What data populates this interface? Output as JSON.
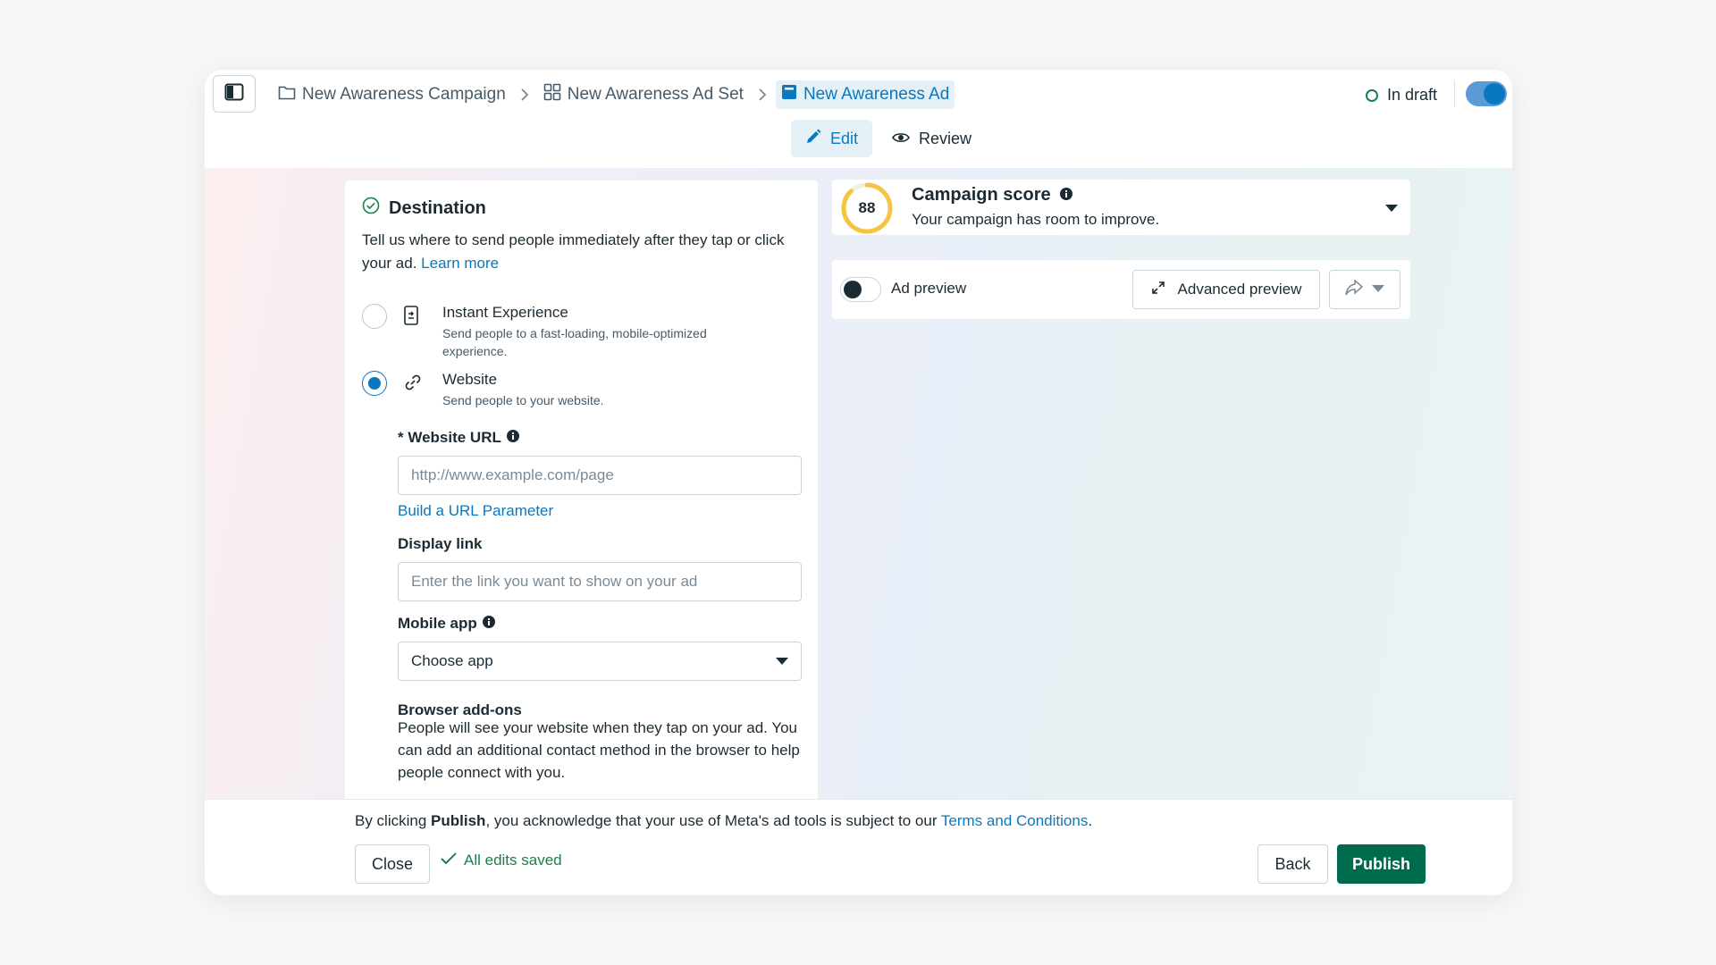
{
  "breadcrumb": {
    "items": [
      {
        "label": "New Awareness Campaign",
        "icon": "folder-icon"
      },
      {
        "label": "New Awareness Ad Set",
        "icon": "grid-icon"
      },
      {
        "label": "New Awareness Ad",
        "icon": "ad-icon"
      }
    ]
  },
  "status": {
    "label": "In draft"
  },
  "tabs": [
    {
      "label": "Edit",
      "icon": "pencil-icon",
      "active": true
    },
    {
      "label": "Review",
      "icon": "eye-icon",
      "active": false
    }
  ],
  "destination": {
    "title": "Destination",
    "description": "Tell us where to send people immediately after they tap or click your ad.",
    "learn_more": "Learn more",
    "options": [
      {
        "title": "Instant Experience",
        "subtitle": "Send people to a fast-loading, mobile-optimized experience.",
        "selected": false
      },
      {
        "title": "Website",
        "subtitle": "Send people to your website.",
        "selected": true
      }
    ],
    "website_url": {
      "label": "* Website URL",
      "placeholder": "http://www.example.com/page",
      "value": ""
    },
    "build_param": "Build a URL Parameter",
    "display_link": {
      "label": "Display link",
      "placeholder": "Enter the link you want to show on your ad",
      "value": ""
    },
    "mobile_app": {
      "label": "Mobile app",
      "selected": "Choose app"
    },
    "browser_addons": {
      "title": "Browser add-ons",
      "description": "People will see your website when they tap on your ad. You can add an additional contact method in the browser to help people connect with you."
    }
  },
  "campaign_score": {
    "score": "88",
    "score_fraction": 0.88,
    "title": "Campaign score",
    "subtitle": "Your campaign has room to improve.",
    "ring_color": "#f5c542"
  },
  "preview": {
    "toggle_label": "Ad preview",
    "advanced_label": "Advanced preview"
  },
  "footer": {
    "legal_prefix": "By clicking",
    "legal_bold": "Publish",
    "legal_middle": ", you acknowledge that your use of Meta's ad tools is subject to our",
    "legal_link": "Terms and Conditions",
    "legal_end": ".",
    "close_label": "Close",
    "saved_label": "All edits saved",
    "back_label": "Back",
    "publish_label": "Publish"
  },
  "colors": {
    "accent": "#0a78be",
    "publish": "#006a4e",
    "success": "#1a7f4b"
  }
}
